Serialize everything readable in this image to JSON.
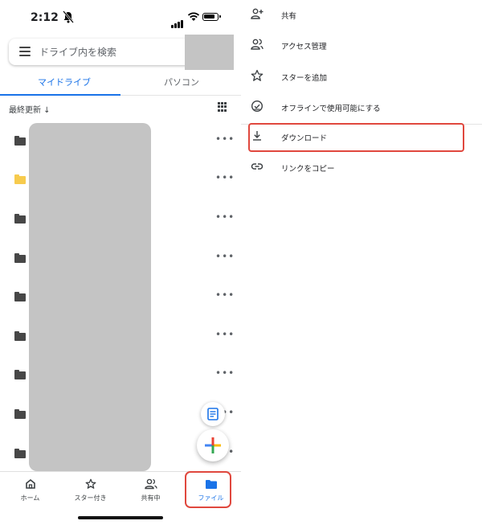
{
  "status_bar": {
    "time": "2:12"
  },
  "search": {
    "placeholder": "ドライブ内を検索"
  },
  "tabs": {
    "my_drive": "マイドライブ",
    "computers": "パソコン"
  },
  "sort": {
    "label": "最終更新 ↓"
  },
  "files": [
    {
      "icon": "folder-icon",
      "color": "#474747",
      "more": "•••"
    },
    {
      "icon": "folder-icon",
      "color": "#f7cb4d",
      "more": "•••"
    },
    {
      "icon": "folder-icon",
      "color": "#474747",
      "more": "•••"
    },
    {
      "icon": "folder-icon",
      "color": "#474747",
      "more": "•••"
    },
    {
      "icon": "folder-icon",
      "color": "#474747",
      "more": "•••"
    },
    {
      "icon": "folder-icon",
      "color": "#474747",
      "more": "•••"
    },
    {
      "icon": "folder-icon",
      "color": "#474747",
      "more": "•••"
    },
    {
      "icon": "folder-icon",
      "color": "#474747",
      "more": "•••"
    },
    {
      "icon": "folder-icon",
      "color": "#474747",
      "more": "•••"
    }
  ],
  "bottom_nav": {
    "home": "ホーム",
    "starred": "スター付き",
    "shared": "共有中",
    "files": "ファイル"
  },
  "context_menu": [
    {
      "icon": "add-person-icon",
      "label": "共有"
    },
    {
      "icon": "manage-access-icon",
      "label": "アクセス管理"
    },
    {
      "icon": "star-icon",
      "label": "スターを追加"
    },
    {
      "icon": "offline-icon",
      "label": "オフラインで使用可能にする"
    },
    {
      "icon": "download-icon",
      "label": "ダウンロード"
    },
    {
      "icon": "link-icon",
      "label": "リンクをコピー"
    }
  ],
  "colors": {
    "accent": "#1a73e8",
    "highlight": "#e0483e"
  }
}
